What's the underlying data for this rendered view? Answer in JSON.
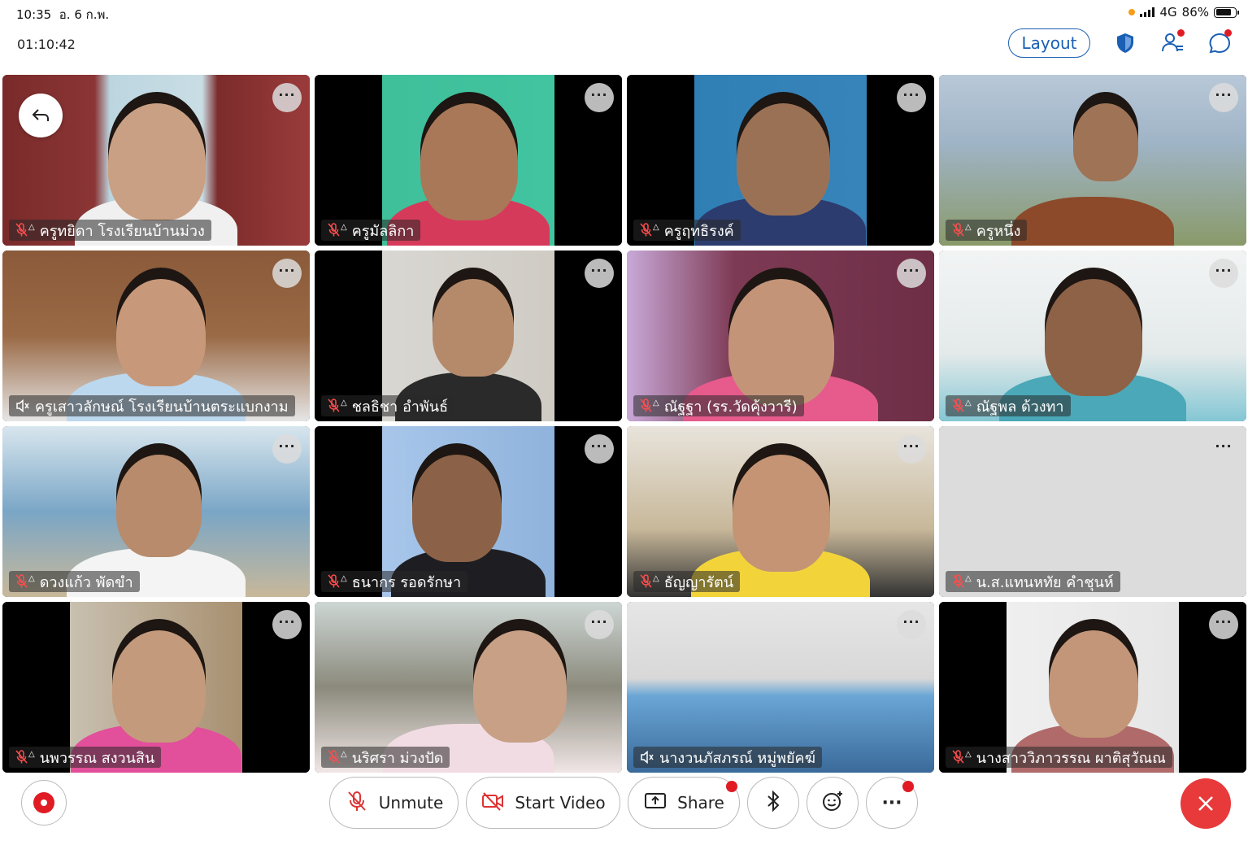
{
  "status_bar": {
    "time": "10:35",
    "date": "อ. 6 ก.พ.",
    "network": "4G",
    "battery": "86%",
    "battery_level": 0.86
  },
  "meeting": {
    "elapsed": "01:10:42",
    "layout_label": "Layout"
  },
  "icons": {
    "security": "shield-icon",
    "participants": "participants-icon",
    "chat": "chat-icon",
    "back": "back-arrow-icon"
  },
  "participants": [
    {
      "name": "ครูทยิดา โรงเรียนบ้านม่วง",
      "audio": "muted"
    },
    {
      "name": "ครูมัลลิกา",
      "audio": "muted"
    },
    {
      "name": "ครูฤทธิรงค์",
      "audio": "muted"
    },
    {
      "name": "ครูหนึ่ง",
      "audio": "muted"
    },
    {
      "name": "ครูเสาวลักษณ์ โรงเรียนบ้านตระแบกงาม",
      "audio": "speaker-off"
    },
    {
      "name": "ชลธิชา อำพันธ์",
      "audio": "muted"
    },
    {
      "name": "ณัฐฐา (รร.วัดคุ้งวารี)",
      "audio": "muted"
    },
    {
      "name": "ณัฐพล ด้วงทา",
      "audio": "muted"
    },
    {
      "name": "ดวงแก้ว พัดขำ",
      "audio": "muted"
    },
    {
      "name": "ธนากร รอดรักษา",
      "audio": "muted"
    },
    {
      "name": "ธัญญารัตน์",
      "audio": "muted"
    },
    {
      "name": "น.ส.แทนหทัย คำชุนห์",
      "audio": "muted"
    },
    {
      "name": "นพวรรณ สงวนสิน",
      "audio": "muted"
    },
    {
      "name": "นริศรา ม่วงปัด",
      "audio": "muted"
    },
    {
      "name": "นางวนภัสภรณ์ หมู่พยัคฆ์",
      "audio": "speaker-off"
    },
    {
      "name": "นางสาววิภาวรรณ ผาติสุวัณณ",
      "audio": "muted"
    }
  ],
  "tile_more_label": "···",
  "controls": {
    "unmute": "Unmute",
    "start_video": "Start Video",
    "share": "Share",
    "more": "···"
  }
}
